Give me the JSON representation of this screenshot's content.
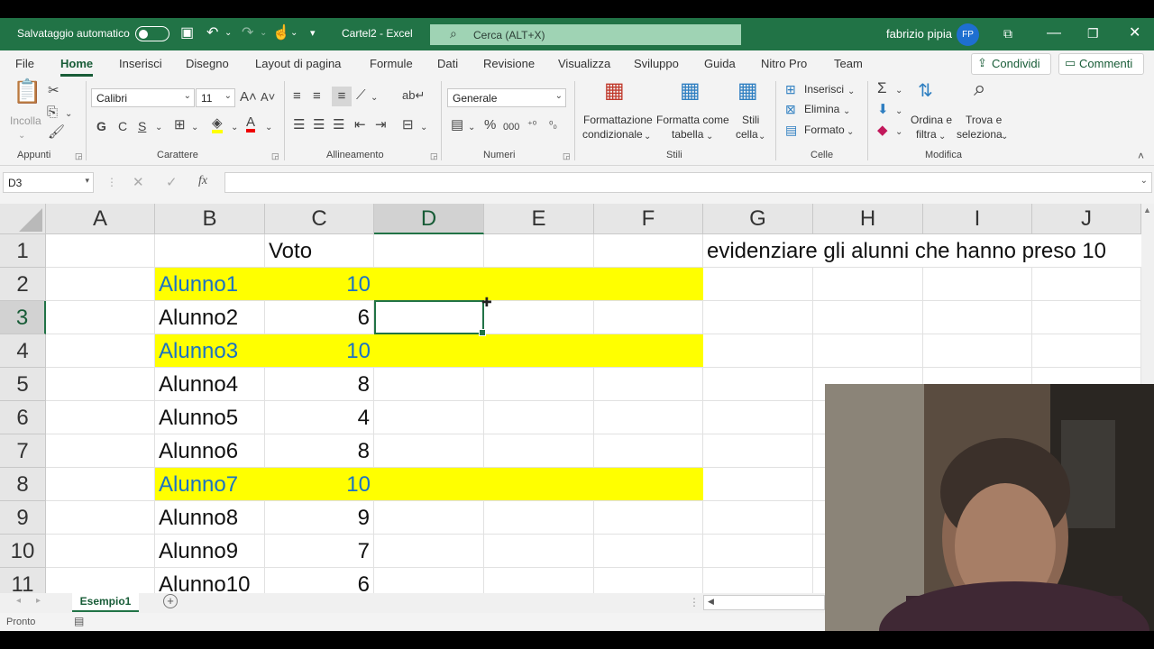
{
  "titlebar": {
    "autosave_label": "Salvataggio automatico",
    "filename": "Cartel2 - Excel",
    "search_placeholder": "Cerca (ALT+X)",
    "user_name": "fabrizio pipia",
    "user_initials": "FP"
  },
  "menu": {
    "tabs": [
      "File",
      "Home",
      "Inserisci",
      "Disegno",
      "Layout di pagina",
      "Formule",
      "Dati",
      "Revisione",
      "Visualizza",
      "Sviluppo",
      "Guida",
      "Nitro Pro",
      "Team"
    ],
    "active_tab": "Home",
    "share_label": "Condividi",
    "comments_label": "Commenti"
  },
  "ribbon": {
    "clipboard": {
      "paste_label": "Incolla",
      "group_label": "Appunti"
    },
    "font": {
      "font_name": "Calibri",
      "font_size": "11",
      "bold": "G",
      "italic": "C",
      "underline": "S",
      "group_label": "Carattere"
    },
    "alignment": {
      "group_label": "Allineamento"
    },
    "number": {
      "format": "Generale",
      "group_label": "Numeri"
    },
    "styles": {
      "conditional_l1": "Formattazione",
      "conditional_l2": "condizionale",
      "table_l1": "Formatta come",
      "table_l2": "tabella",
      "cell_l1": "Stili",
      "cell_l2": "cella",
      "group_label": "Stili"
    },
    "cells": {
      "insert": "Inserisci",
      "delete": "Elimina",
      "format": "Formato",
      "group_label": "Celle"
    },
    "editing": {
      "sort_l1": "Ordina e",
      "sort_l2": "filtra",
      "find_l1": "Trova e",
      "find_l2": "seleziona",
      "group_label": "Modifica"
    }
  },
  "formula_bar": {
    "name_box": "D3",
    "formula": "",
    "fx": "fx"
  },
  "sheet": {
    "columns": [
      "A",
      "B",
      "C",
      "D",
      "E",
      "F",
      "G",
      "H",
      "I",
      "J"
    ],
    "selected_column": "D",
    "rows": [
      "1",
      "2",
      "3",
      "4",
      "5",
      "6",
      "7",
      "8",
      "9",
      "10",
      "11"
    ],
    "selected_row": "3",
    "header_c1": "Voto",
    "note_g1": "evidenziare gli alunni che hanno preso 10",
    "students": [
      {
        "name": "Alunno1",
        "grade": "10",
        "highlight": true
      },
      {
        "name": "Alunno2",
        "grade": "6",
        "highlight": false
      },
      {
        "name": "Alunno3",
        "grade": "10",
        "highlight": true
      },
      {
        "name": "Alunno4",
        "grade": "8",
        "highlight": false
      },
      {
        "name": "Alunno5",
        "grade": "4",
        "highlight": false
      },
      {
        "name": "Alunno6",
        "grade": "8",
        "highlight": false
      },
      {
        "name": "Alunno7",
        "grade": "10",
        "highlight": true
      },
      {
        "name": "Alunno8",
        "grade": "9",
        "highlight": false
      },
      {
        "name": "Alunno9",
        "grade": "7",
        "highlight": false
      },
      {
        "name": "Alunno10",
        "grade": "6",
        "highlight": false
      }
    ],
    "highlight_color": "#ffff00",
    "highlight_text_color": "#1a72c4"
  },
  "sheet_tabs": {
    "active": "Esempio1"
  },
  "status": {
    "ready": "Pronto"
  },
  "colors": {
    "accent": "#217346"
  }
}
